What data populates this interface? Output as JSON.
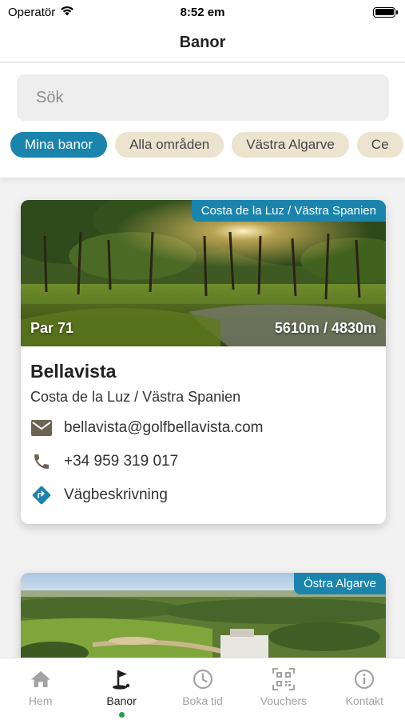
{
  "status_bar": {
    "carrier": "Operatör",
    "time": "8:52 em"
  },
  "header": {
    "title": "Banor"
  },
  "search": {
    "placeholder": "Sök",
    "value": ""
  },
  "filters": [
    {
      "label": "Mina banor",
      "active": true
    },
    {
      "label": "Alla områden",
      "active": false
    },
    {
      "label": "Västra Algarve",
      "active": false
    },
    {
      "label": "Ce",
      "active": false
    }
  ],
  "courses": [
    {
      "region_tag": "Costa de la Luz / Västra Spanien",
      "par": "Par 71",
      "length": "5610m / 4830m",
      "name": "Bellavista",
      "region": "Costa de la Luz / Västra Spanien",
      "email": "bellavista@golfbellavista.com",
      "phone": "+34 959 319 017",
      "directions": "Vägbeskrivning"
    },
    {
      "region_tag": "Östra Algarve"
    }
  ],
  "tabs": [
    {
      "label": "Hem",
      "icon": "home-icon",
      "active": false
    },
    {
      "label": "Banor",
      "icon": "golf-flag-icon",
      "active": true
    },
    {
      "label": "Boka tid",
      "icon": "clock-icon",
      "active": false
    },
    {
      "label": "Vouchers",
      "icon": "qr-code-icon",
      "active": false
    },
    {
      "label": "Kontakt",
      "icon": "info-icon",
      "active": false
    }
  ],
  "colors": {
    "accent": "#1a84ad",
    "chip_inactive": "#ece4cf",
    "active_dot": "#22a050"
  }
}
